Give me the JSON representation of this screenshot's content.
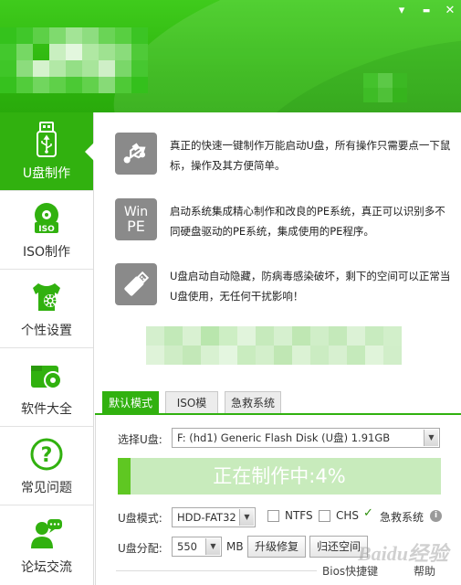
{
  "window": {
    "menu_icon": "▾",
    "minimize_icon": "▬",
    "close_icon": "✕"
  },
  "colors": {
    "brand_green": "#31b10f",
    "progress_bg": "#c8ebbc",
    "progress_fill": "#5fc722"
  },
  "sidebar": {
    "items": [
      {
        "label": "U盘制作",
        "icon": "usb-icon",
        "active": true
      },
      {
        "label": "ISO制作",
        "icon": "disc-icon",
        "active": false
      },
      {
        "label": "个性设置",
        "icon": "shirt-gear-icon",
        "active": false
      },
      {
        "label": "软件大全",
        "icon": "software-icon",
        "active": false
      },
      {
        "label": "常见问题",
        "icon": "question-icon",
        "active": false
      },
      {
        "label": "论坛交流",
        "icon": "forum-icon",
        "active": false
      }
    ]
  },
  "features": [
    {
      "icon": "usb-symbol-icon",
      "text": "真正的快速一键制作万能启动U盘，所有操作只需要点一下鼠标，操作及其方便简单。"
    },
    {
      "icon": "winpe-icon",
      "icon_text_1": "Win",
      "icon_text_2": "PE",
      "text": "启动系统集成精心制作和改良的PE系统，真正可以识别多不同硬盘驱动的PE系统，集成使用的PE程序。"
    },
    {
      "icon": "usb-drive-icon",
      "text": "U盘启动自动隐藏，防病毒感染破坏，剩下的空间可以正常当U盘使用，无任何干扰影响！"
    }
  ],
  "tabs": [
    {
      "label": "默认模式",
      "active": true
    },
    {
      "label": "ISO模式",
      "active": false
    },
    {
      "label": "急救系统",
      "active": false
    }
  ],
  "panel": {
    "select_usb_label": "选择U盘:",
    "select_usb_value": "F: (hd1) Generic Flash Disk (U盘) 1.91GB",
    "progress_text": "正在制作中:4%",
    "progress_value": 4,
    "usb_mode_label": "U盘模式:",
    "usb_mode_value": "HDD-FAT32",
    "ntfs_label": "NTFS",
    "ntfs_checked": false,
    "chs_label": "CHS",
    "chs_checked": false,
    "rescue_label": "急救系统",
    "rescue_checked": true,
    "partition_label": "U盘分配:",
    "partition_value": "550",
    "partition_unit": "MB",
    "upgrade_button": "升级修复",
    "restore_button": "归还空间",
    "bios_link": "Bios快捷键",
    "help_link": "帮助"
  },
  "watermark": "Baidu经验"
}
